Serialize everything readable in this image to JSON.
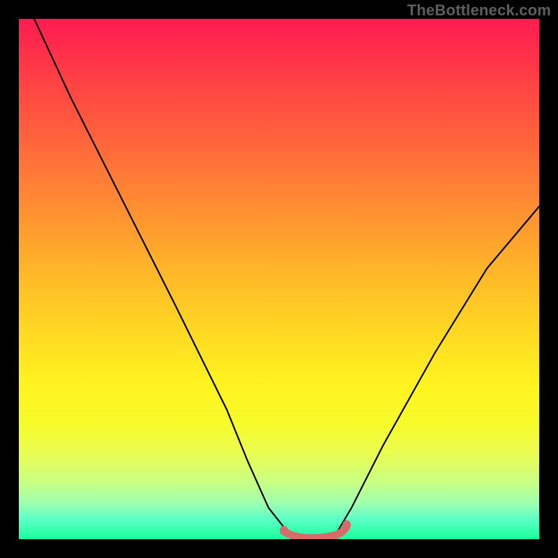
{
  "watermark": "TheBottleneck.com",
  "chart_data": {
    "type": "line",
    "title": "",
    "xlabel": "",
    "ylabel": "",
    "xlim": [
      0,
      100
    ],
    "ylim": [
      0,
      100
    ],
    "annotations": [],
    "series": [
      {
        "name": "main-curve",
        "color": "#000000",
        "x": [
          3,
          10,
          20,
          30,
          40,
          44,
          48,
          52,
          55,
          58,
          61,
          64,
          70,
          80,
          90,
          100
        ],
        "y": [
          100,
          85,
          65,
          45,
          25,
          15,
          6,
          1,
          0,
          0,
          1,
          6,
          18,
          36,
          52,
          64
        ]
      },
      {
        "name": "highlight-band",
        "color": "#e06666",
        "x": [
          51,
          53,
          55,
          57,
          59,
          61,
          63
        ],
        "y": [
          1.5,
          0.6,
          0.3,
          0.3,
          0.5,
          1.0,
          2.5
        ]
      }
    ]
  }
}
